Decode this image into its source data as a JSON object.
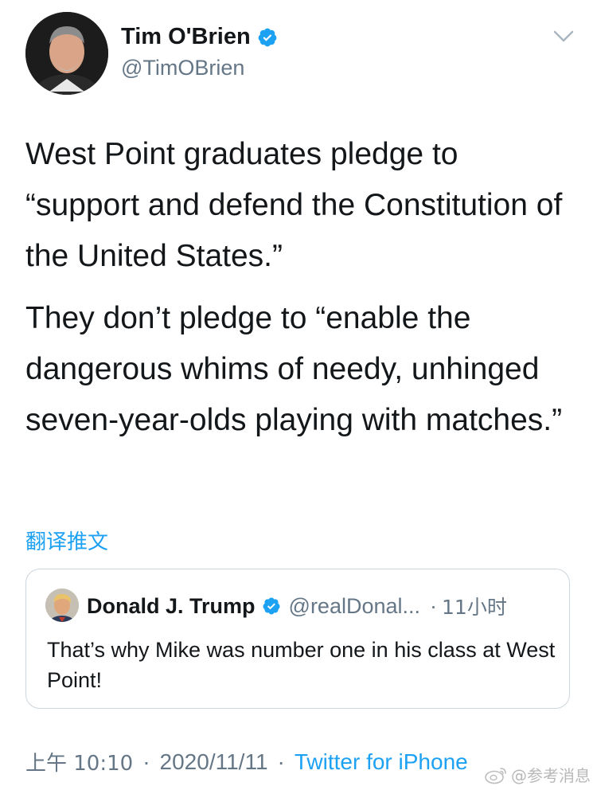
{
  "author": {
    "display_name": "Tim O'Brien",
    "handle": "@TimOBrien",
    "verified": true
  },
  "tweet": {
    "paragraphs": [
      "West Point graduates pledge to “support and defend the Constitution of the United States.”",
      "They don’t pledge to “enable the dangerous whims of needy, unhinged seven-year-olds playing with matches.”"
    ],
    "translate_label": "翻译推文"
  },
  "quoted_tweet": {
    "display_name": "Donald J. Trump",
    "handle": "@realDonal...",
    "separator": "·",
    "time": "11小时",
    "text": "That’s why Mike was number one in his class at West Point!"
  },
  "meta": {
    "time": "上午 10:10",
    "separator": "·",
    "date": "2020/11/11",
    "source": "Twitter for iPhone"
  },
  "watermark": {
    "text": "@参考消息"
  },
  "colors": {
    "link_blue": "#1da1f2",
    "secondary_gray": "#657786",
    "text_black": "#14171a",
    "border": "#ccd6dd"
  },
  "icons": {
    "verified": "verified-badge-icon",
    "caret": "chevron-down-icon",
    "watermark": "weibo-icon"
  }
}
